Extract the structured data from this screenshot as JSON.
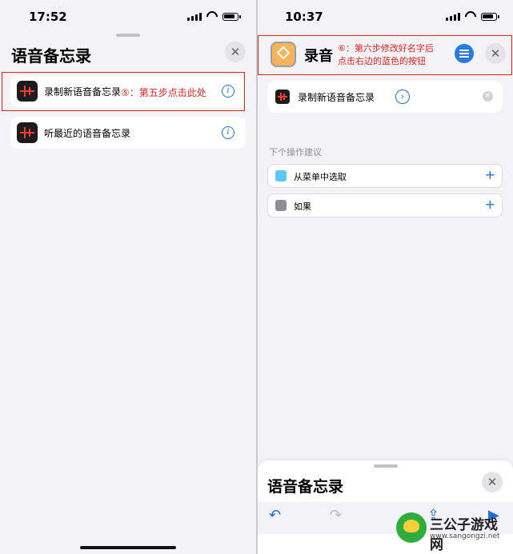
{
  "left": {
    "status_time": "17:52",
    "sheet_title": "语音备忘录",
    "close_label": "✕",
    "rows": [
      {
        "label": "录制新语音备忘录",
        "info": "i"
      },
      {
        "label": "听最近的语音备忘录",
        "info": "i"
      }
    ],
    "annotation": "⑤：第五步点击此处"
  },
  "right": {
    "status_time": "10:37",
    "header_title": "录音",
    "annotation_line1": "⑥：第六步修改好名字后",
    "annotation_line2": "点击右边的蓝色的按钮",
    "close_label": "✕",
    "action_label": "录制新语音备忘录",
    "action_chevron": "›",
    "clear_label": "✕",
    "suggestions_header": "下个操作建议",
    "suggestions": [
      {
        "label": "从菜单中选取",
        "plus": "+",
        "icon": "menu-icon",
        "color": "#5ac8fa"
      },
      {
        "label": "如果",
        "plus": "+",
        "icon": "branch-icon",
        "color": "#8e8e93"
      }
    ],
    "bottom_sheet_title": "语音备忘录",
    "bottom_close_label": "✕",
    "toolbar": {
      "undo": "↶",
      "redo": "↷",
      "share": "⇪",
      "run": "▶"
    }
  },
  "watermark": {
    "name": "三公子游戏网",
    "url": "www.sangongzi.net"
  },
  "colors": {
    "accent": "#1e6fd9",
    "annotation_red": "#e0241f",
    "background": "#f2f2f7"
  }
}
